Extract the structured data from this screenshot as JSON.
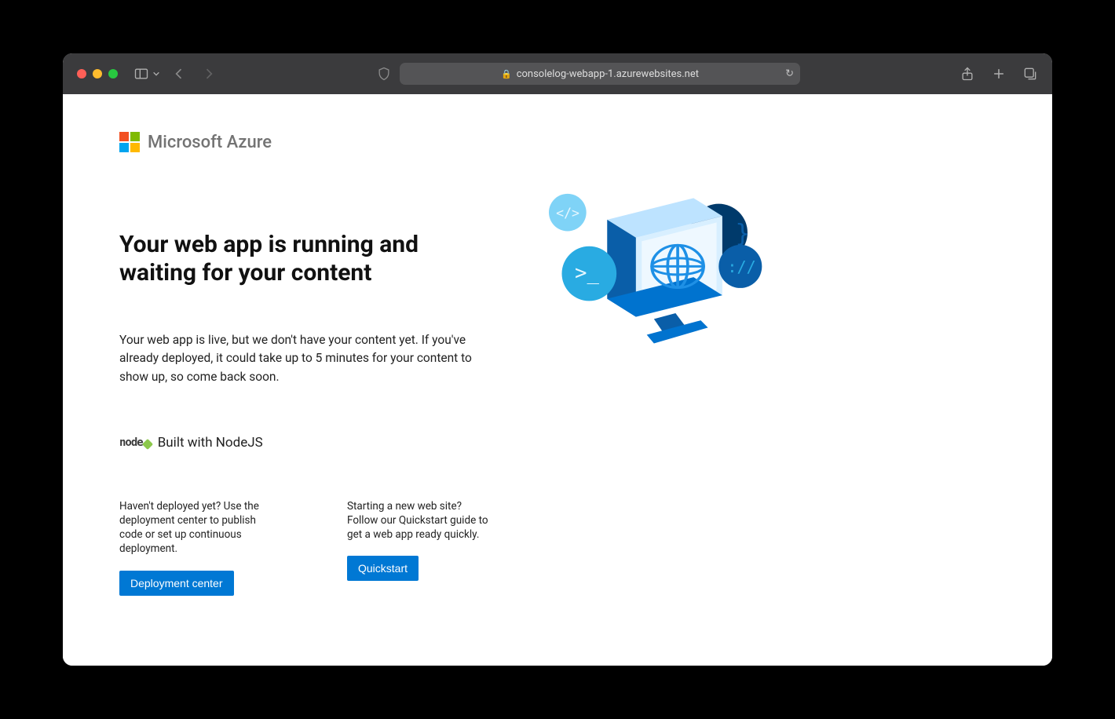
{
  "browser": {
    "url": "consolelog-webapp-1.azurewebsites.net"
  },
  "brand": {
    "name": "Microsoft Azure"
  },
  "hero": {
    "heading": "Your web app is running and waiting for your content",
    "sub": "Your web app is live, but we don't have your content yet. If you've already deployed, it could take up to 5 minutes for your content to show up, so come back soon."
  },
  "built": {
    "logo_text": "node",
    "label": "Built with NodeJS"
  },
  "cards": {
    "deploy": {
      "text": "Haven't deployed yet? Use the deployment center to publish code or set up continuous deployment.",
      "button": "Deployment center"
    },
    "quickstart": {
      "text": "Starting a new web site? Follow our Quickstart guide to get a web app ready quickly.",
      "button": "Quickstart"
    }
  },
  "colors": {
    "azure_blue": "#0078d4"
  }
}
